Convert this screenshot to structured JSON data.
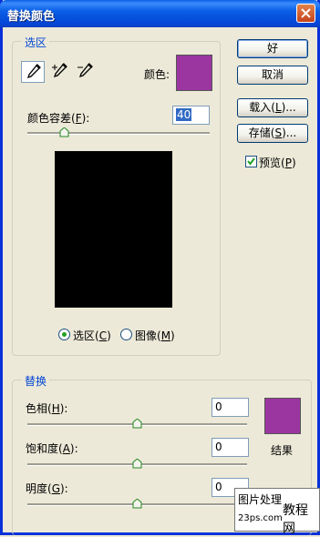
{
  "window": {
    "title": "替换颜色"
  },
  "selection": {
    "group_label": "选区",
    "color_label": "颜色:",
    "fuzziness_label": "颜色容差(F):",
    "fuzziness_value": "40",
    "fuzziness_fraction": 0.2,
    "radio_selection": "选区(C)",
    "radio_image": "图像(M)",
    "selected_radio": "selection"
  },
  "buttons": {
    "ok": "好",
    "cancel": "取消",
    "load": "载入(L)...",
    "save": "存储(S)..."
  },
  "preview": {
    "label": "预览(P)",
    "checked": true
  },
  "replacement": {
    "group_label": "替换",
    "hue_label": "色相(H):",
    "hue_value": "0",
    "saturation_label": "饱和度(A):",
    "saturation_value": "0",
    "lightness_label": "明度(G):",
    "lightness_value": "0",
    "result_label": "结果"
  },
  "watermark": {
    "line1": "图片处理",
    "line2": "教程网",
    "line3": "23ps.com"
  },
  "colors": {
    "selected_color": "#9b36a1",
    "result_color": "#9b36a1",
    "preview_bg": "#000000",
    "accent_blue": "#0046d5"
  }
}
